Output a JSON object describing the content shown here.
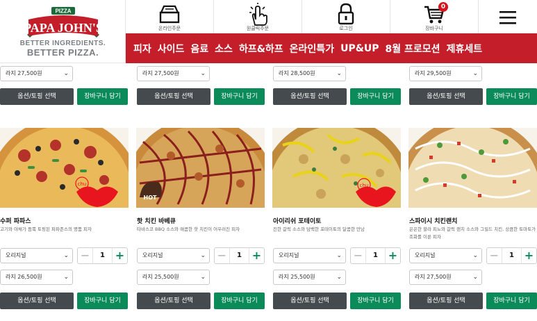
{
  "brand": {
    "badge": "PIZZA",
    "name_line1": "PAPA JOHN'S",
    "tagline1": "BETTER INGREDIENTS.",
    "tagline2": "BETTER PIZZA.",
    "color_red": "#c41e2a",
    "color_green": "#0b8a5a"
  },
  "iconbar": [
    {
      "label": "온라인주문",
      "icon": "delivery-box-icon"
    },
    {
      "label": "원클릭주문",
      "icon": "one-click-hand-icon"
    },
    {
      "label": "로그인",
      "icon": "lock-icon"
    },
    {
      "label": "장바구니",
      "icon": "cart-icon",
      "badge": "0"
    },
    {
      "label": "",
      "icon": "hamburger-menu-icon"
    }
  ],
  "nav": [
    "피자",
    "사이드",
    "음료",
    "소스",
    "하프&하프",
    "온라인특가",
    "UP&UP",
    "8월 프로모션",
    "제휴세트"
  ],
  "top_row": [
    {
      "size": "라지 27,500원"
    },
    {
      "size": "라지 27,500원"
    },
    {
      "size": "라지 28,500원"
    },
    {
      "size": "라지 29,500원"
    }
  ],
  "buttons": {
    "option": "옵션/토핑 선택",
    "cart": "장바구니 담기"
  },
  "products": [
    {
      "name": "수퍼 파파스",
      "desc": "고기와 야채가 듬뿍 토핑된 파파존스의 명품 피자",
      "dough": "오리지널",
      "qty": "1",
      "size": "라지 26,500원",
      "badge": "chu-lips"
    },
    {
      "name": "핫 치킨 바베큐",
      "desc": "타바스코 BBQ 소스와 매콤한 핫 치킨이 어우러진 피자",
      "dough": "오리지널",
      "qty": "1",
      "size": "라지 25,500원",
      "badge": "hot"
    },
    {
      "name": "아이리쉬 포테이토",
      "desc": "진한 갈릭 소스와 담백한 포테이토의 달콤한 만남",
      "dough": "오리지널",
      "qty": "1",
      "size": "라지 25,500원",
      "badge": "chu-lips"
    },
    {
      "name": "스파이시 치킨랜치",
      "desc": "은은한 할라 피뇨와 갈릭 랜치 소스와 그릴드 치킨, 상큼한 토마토가 조화를 이룬 피자",
      "dough": "오리지널",
      "qty": "1",
      "size": "라지 27,500원",
      "badge": ""
    }
  ],
  "badges": {
    "hot": "HOT",
    "chu": "chu"
  }
}
